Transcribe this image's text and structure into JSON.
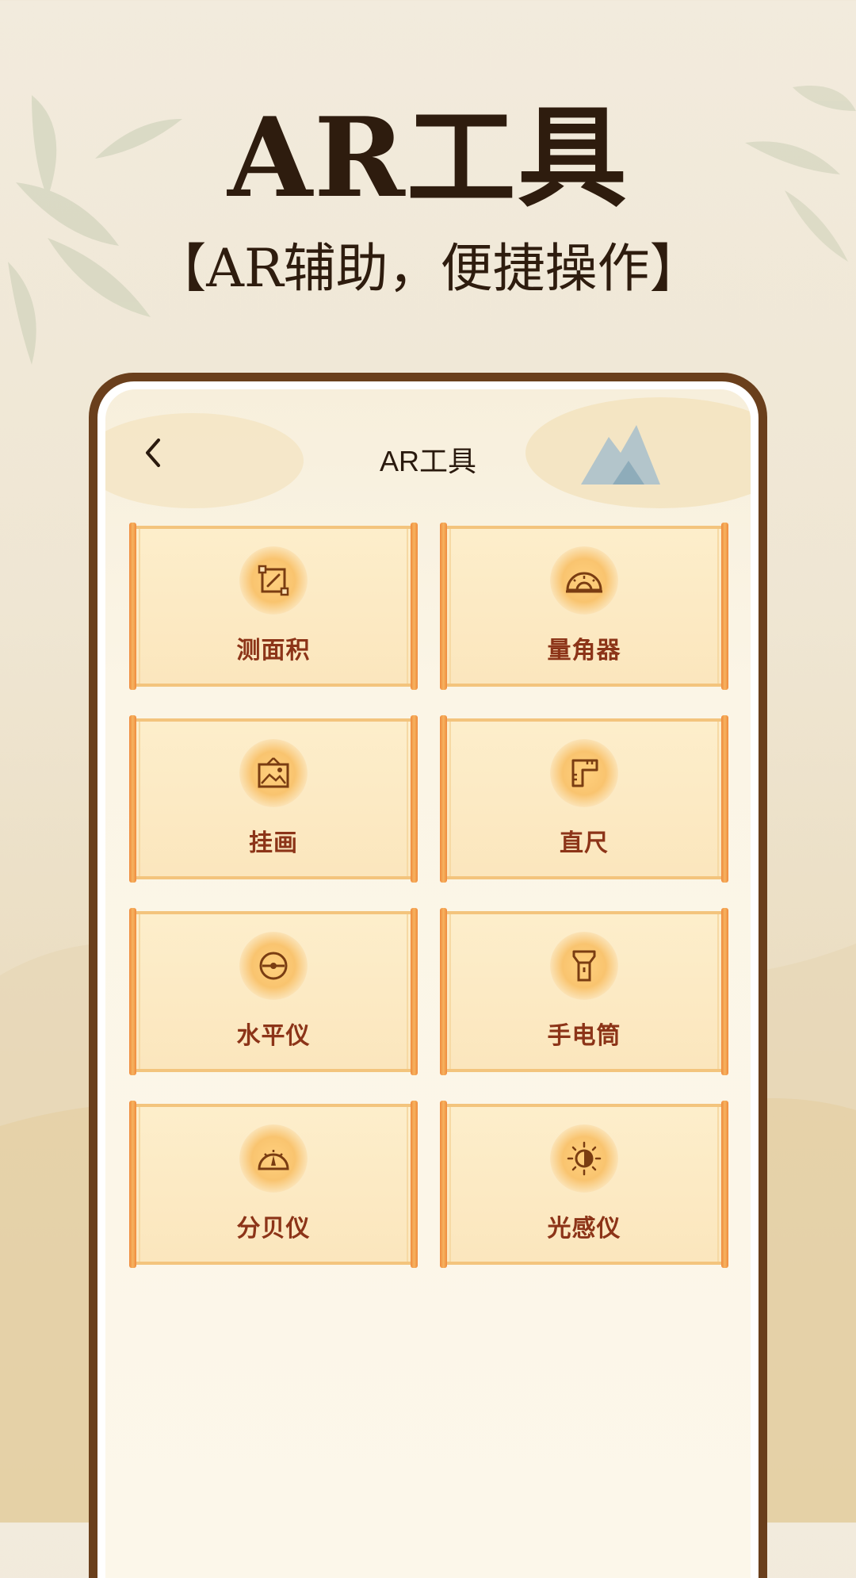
{
  "hero": {
    "title": "AR工具",
    "subtitle": "【AR辅助，便捷操作】"
  },
  "screen": {
    "title": "AR工具",
    "back_icon": "chevron-left-icon"
  },
  "tools": [
    {
      "label": "测面积",
      "icon": "area-measure-icon"
    },
    {
      "label": "量角器",
      "icon": "protractor-icon"
    },
    {
      "label": "挂画",
      "icon": "picture-frame-icon"
    },
    {
      "label": "直尺",
      "icon": "ruler-icon"
    },
    {
      "label": "水平仪",
      "icon": "spirit-level-icon"
    },
    {
      "label": "手电筒",
      "icon": "flashlight-icon"
    },
    {
      "label": "分贝仪",
      "icon": "decibel-meter-icon"
    },
    {
      "label": "光感仪",
      "icon": "light-sensor-icon"
    }
  ],
  "colors": {
    "frame": "#6a3f1c",
    "label": "#8c3418",
    "icon_stroke": "#7a3d12",
    "card_border": "#f3c47d",
    "scroll_rod": "#ef8a3d"
  }
}
